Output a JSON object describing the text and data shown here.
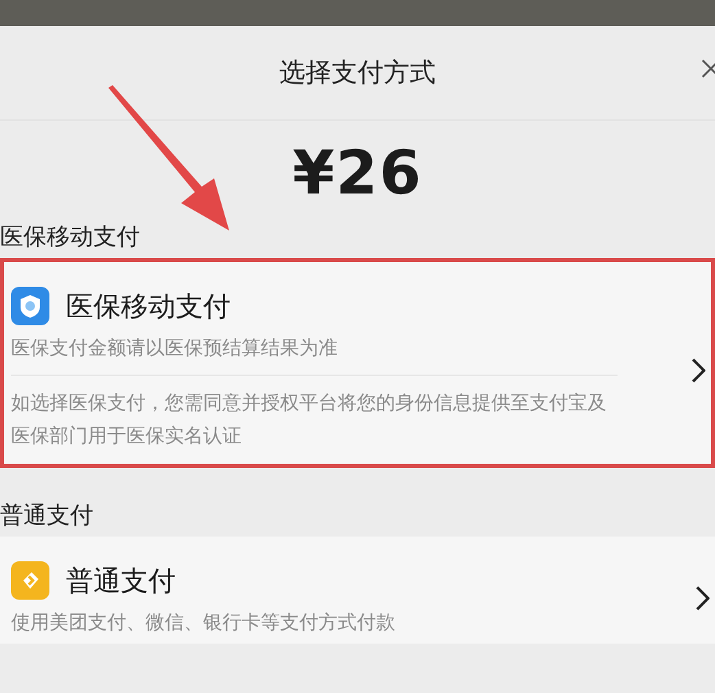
{
  "sheet": {
    "title": "选择支付方式",
    "amount": "¥26"
  },
  "sections": [
    {
      "label": "医保移动支付",
      "highlighted": true,
      "option": {
        "kind": "insurance",
        "title": "医保移动支付",
        "subtitle": "医保支付金额请以医保预结算结果为准",
        "note": "如选择医保支付，您需同意并授权平台将您的身份信息提供至支付宝及医保部门用于医保实名认证"
      }
    },
    {
      "label": "普通支付",
      "highlighted": false,
      "option": {
        "kind": "regular",
        "title": "普通支付",
        "subtitle": "使用美团支付、微信、银行卡等支付方式付款"
      }
    }
  ]
}
